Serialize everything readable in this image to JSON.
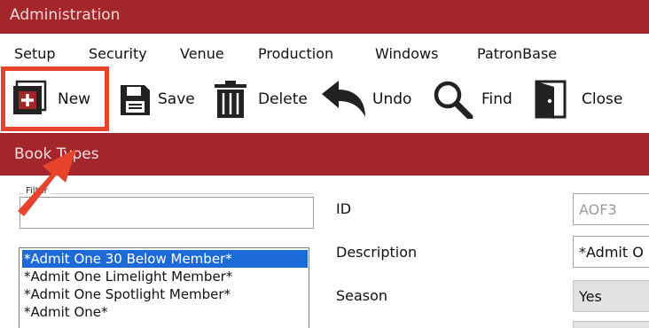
{
  "window": {
    "title": "Administration"
  },
  "menu": {
    "items": [
      "Setup",
      "Security",
      "Venue",
      "Production",
      "Windows",
      "PatronBase"
    ]
  },
  "toolbar": {
    "new_label": "New",
    "save_label": "Save",
    "delete_label": "Delete",
    "undo_label": "Undo",
    "find_label": "Find",
    "close_label": "Close",
    "highlight_color": "#e8432c"
  },
  "section": {
    "title": "Book Types"
  },
  "filter": {
    "legend": "Filter",
    "value": ""
  },
  "list": {
    "items": [
      "*Admit One 30 Below Member*",
      "*Admit One Limelight Member*",
      "*Admit One Spotlight Member*",
      "*Admit One*"
    ],
    "selected_index": 0
  },
  "form": {
    "id_label": "ID",
    "id_value": "AOF3",
    "description_label": "Description",
    "description_value": "*Admit O",
    "season_label": "Season",
    "season_value": "Yes"
  },
  "colors": {
    "brand": "#a3262a",
    "selection": "#1c6ad8"
  }
}
